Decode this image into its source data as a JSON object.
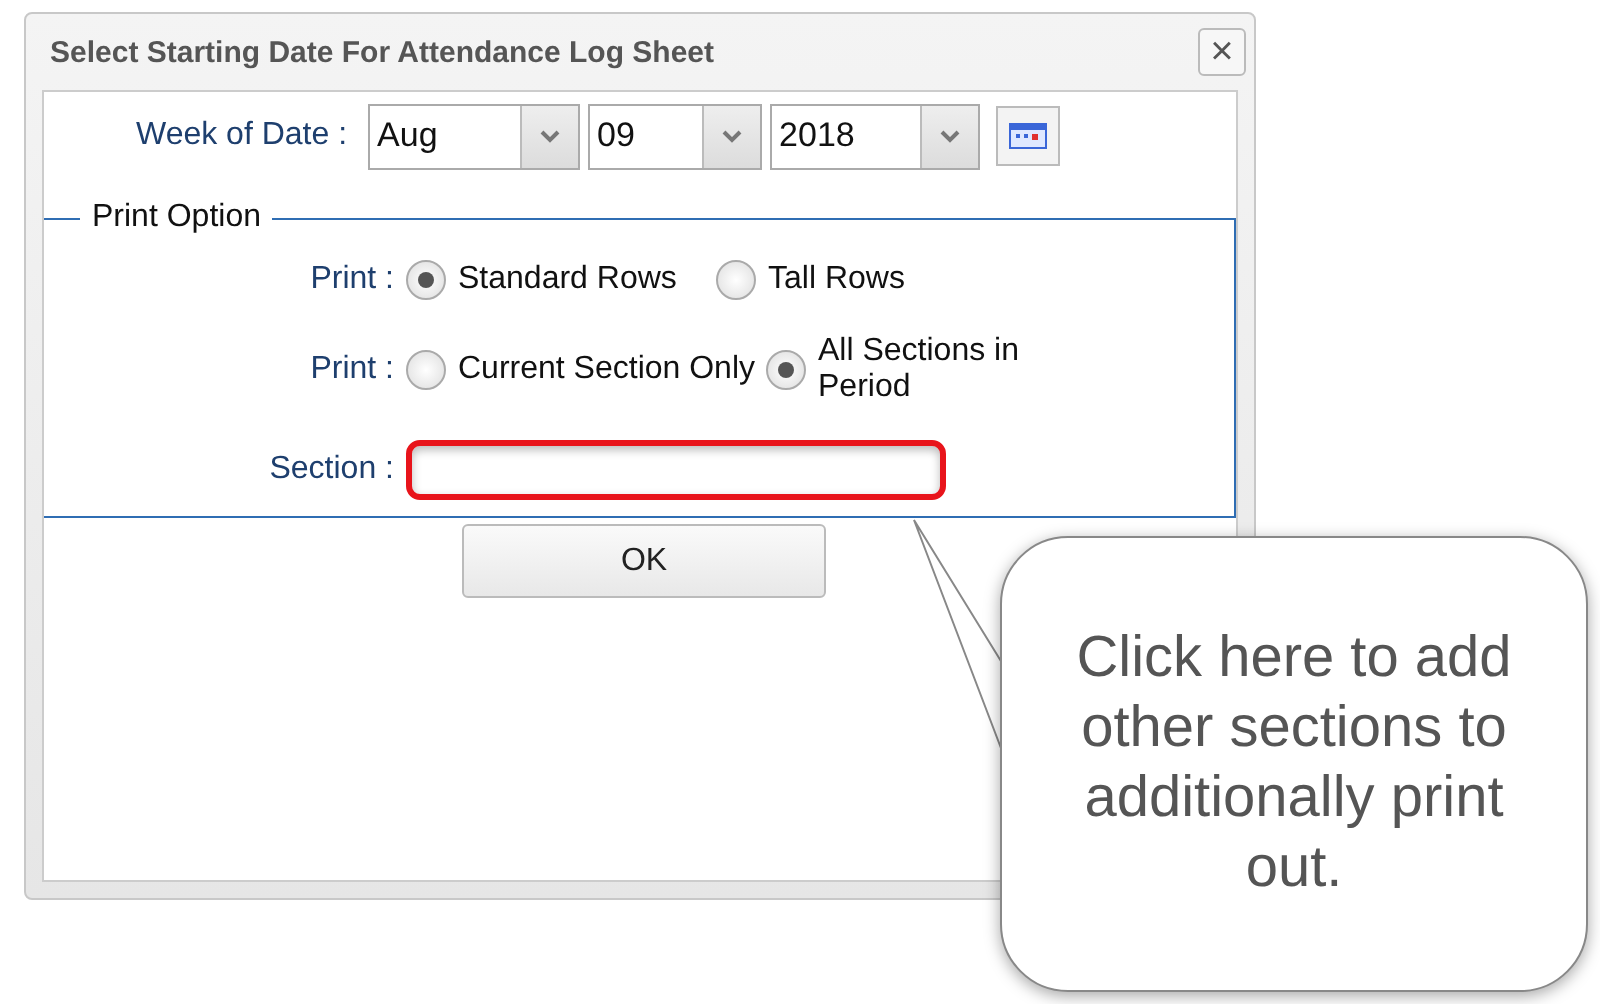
{
  "window": {
    "title": "Select Starting Date For Attendance Log Sheet",
    "close": "×"
  },
  "week_of_date": {
    "label": "Week of Date :",
    "month": "Aug",
    "day": "09",
    "year": "2018"
  },
  "print_option": {
    "legend": "Print Option",
    "rows": [
      {
        "label": "Print :",
        "options": [
          {
            "label": "Standard Rows",
            "selected": true
          },
          {
            "label": "Tall Rows",
            "selected": false
          }
        ]
      },
      {
        "label": "Print :",
        "options": [
          {
            "label": "Current Section Only",
            "selected": false
          },
          {
            "label": "All Sections in Period",
            "selected": true
          }
        ]
      }
    ],
    "section": {
      "label": "Section :"
    }
  },
  "ok_button": "OK",
  "callout": "Click here to add other sections to additionally print out."
}
